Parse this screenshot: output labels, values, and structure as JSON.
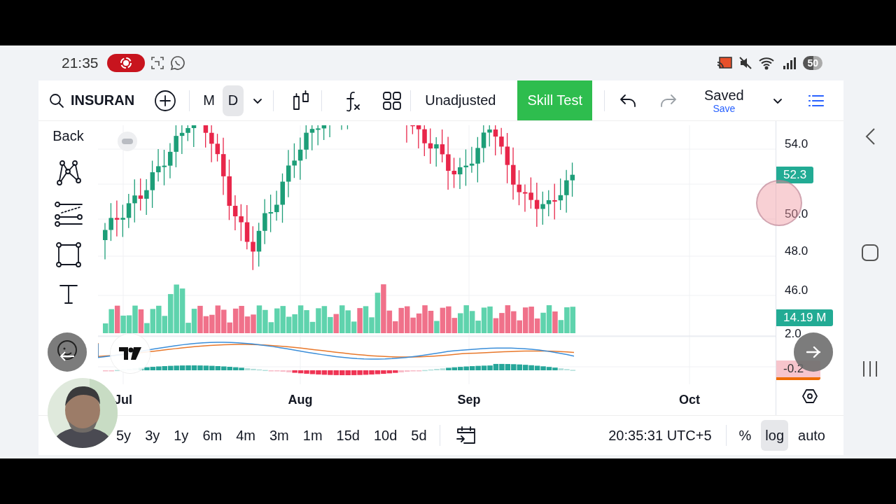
{
  "status_bar": {
    "time": "21:35",
    "battery": "50"
  },
  "toolbar": {
    "symbol": "INSURAN",
    "intervals": [
      {
        "label": "M",
        "selected": false
      },
      {
        "label": "D",
        "selected": true
      }
    ],
    "adjustment": "Unadjusted",
    "skill_test": "Skill Test",
    "redo": {
      "disabled": true
    },
    "save_state": "Saved",
    "save_action": "Save"
  },
  "drawing_tools": {
    "back": "Back"
  },
  "price_axis": {
    "ticks": [
      "54.0",
      "50.0",
      "48.0",
      "46.0",
      "2.0"
    ],
    "last_price": "52.3",
    "volume": "14.19 M",
    "macd": "-0.2"
  },
  "time_axis": [
    "Jul",
    "Aug",
    "Sep",
    "Oct"
  ],
  "ranges": [
    "5y",
    "3y",
    "1y",
    "6m",
    "4m",
    "3m",
    "1m",
    "15d",
    "10d",
    "5d"
  ],
  "footer": {
    "time": "20:35:31 UTC+5",
    "scales": [
      {
        "label": "%",
        "selected": false
      },
      {
        "label": "log",
        "selected": true
      },
      {
        "label": "auto",
        "selected": false
      }
    ]
  }
}
